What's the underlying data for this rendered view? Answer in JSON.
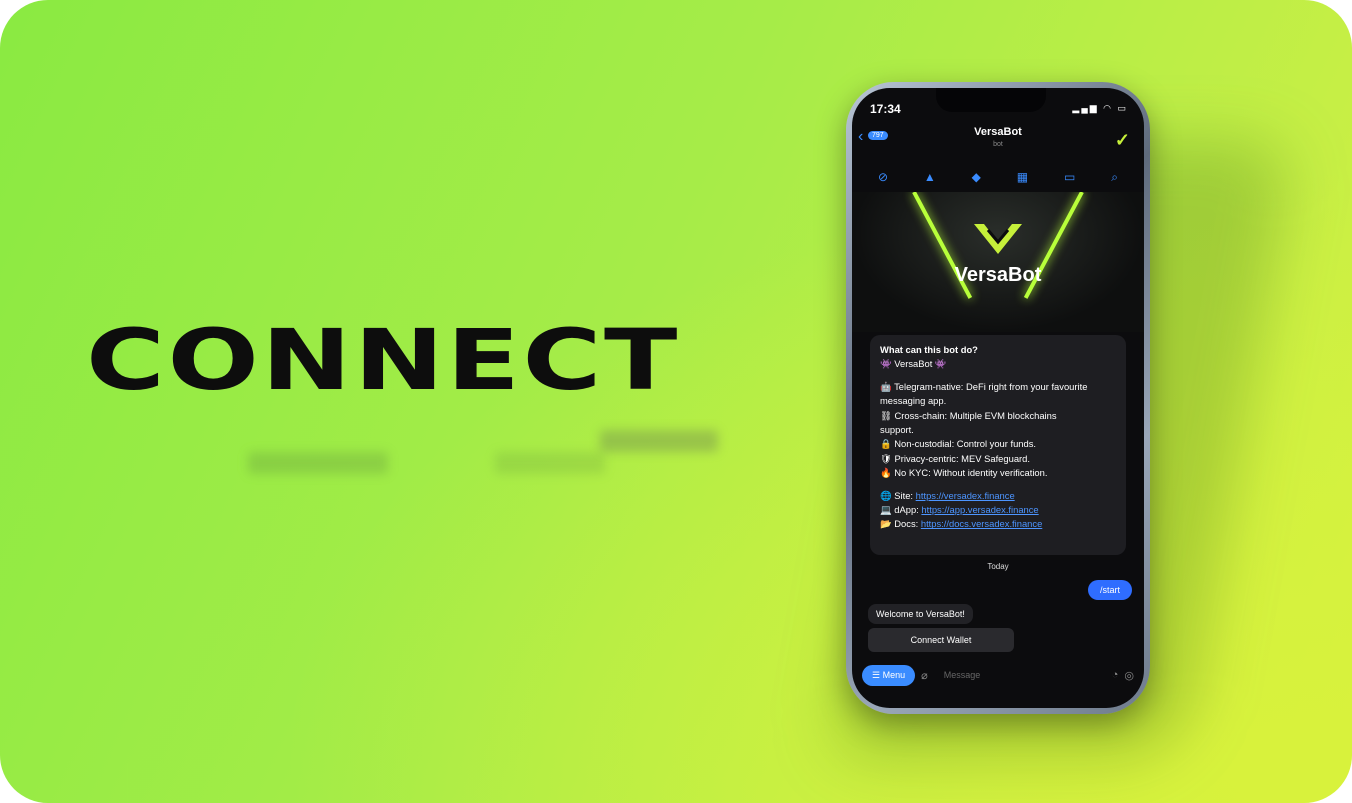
{
  "headline": "CONNECT",
  "phone": {
    "status_time": "17:34",
    "status_icons": "▂▄▆ ◠ ▭",
    "back_badge": "797",
    "chat_title": "VersaBot",
    "chat_subtitle": "bot",
    "toolbar_icons": [
      "⊘",
      "▲",
      "◆",
      "▦",
      "▭",
      "⌕"
    ],
    "banner_brand": "VersaBot",
    "bot_info": {
      "question": "What can this bot do?",
      "name_line": "👾 VersaBot 👾",
      "lines": [
        "🤖 Telegram-native: DeFi right from your favourite",
        "messaging app.",
        "⛓ Cross-chain: Multiple EVM blockchains",
        "support.",
        "🔒 Non-custodial: Control your funds.",
        "🛡 Privacy-centric: MEV Safeguard.",
        "🔥 No KYC: Without identity verification."
      ],
      "links": [
        {
          "label": "🌐 Site: ",
          "url": "https://versadex.finance"
        },
        {
          "label": "💻 dApp: ",
          "url": "https://app.versadex.finance"
        },
        {
          "label": "📂 Docs: ",
          "url": "https://docs.versadex.finance"
        }
      ]
    },
    "date_label": "Today",
    "start_button": "/start",
    "welcome_message": "Welcome to VersaBot!",
    "connect_wallet": "Connect Wallet",
    "menu_button": "☰ Menu",
    "message_placeholder": "Message"
  },
  "colors": {
    "accent": "#c6f03a",
    "telegram_blue": "#3a8cff"
  }
}
